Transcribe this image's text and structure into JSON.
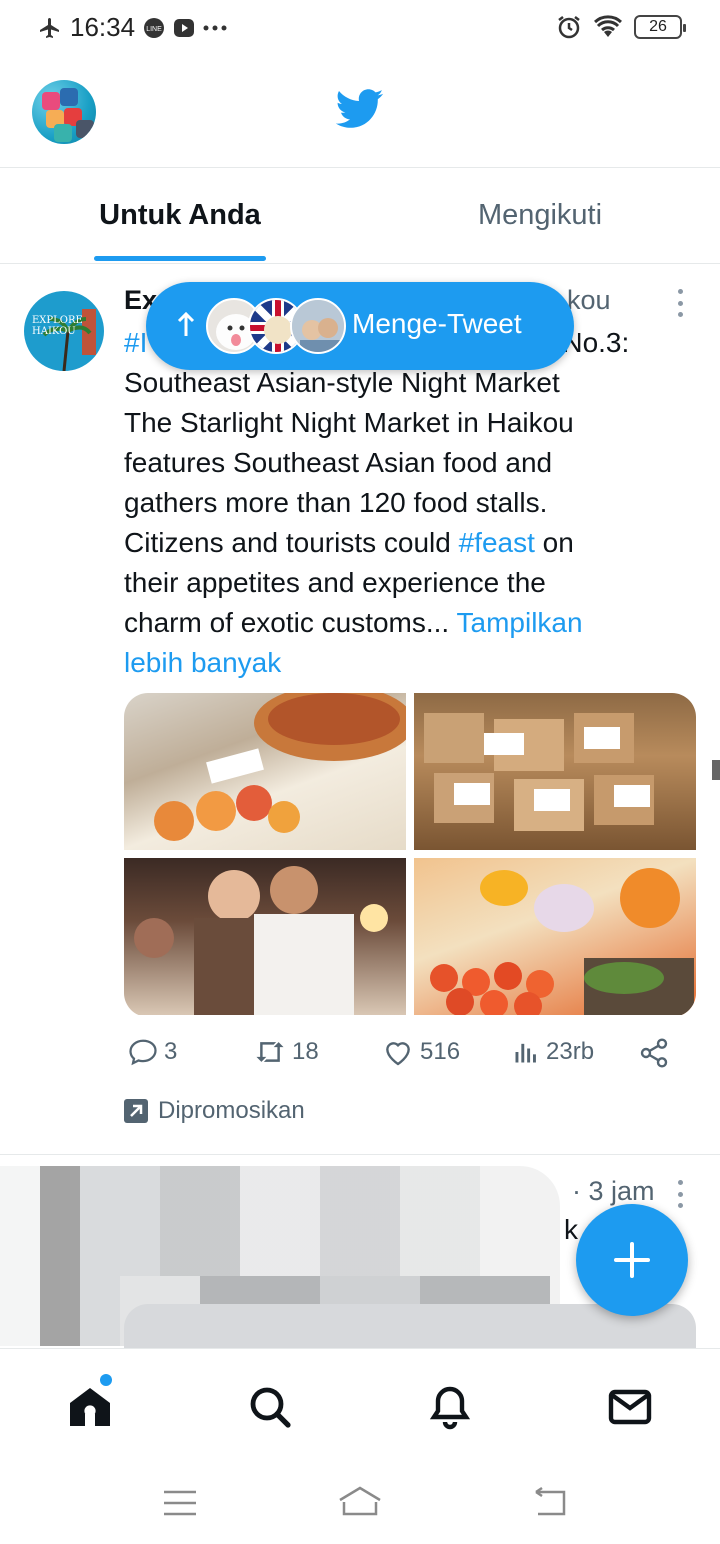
{
  "status_bar": {
    "time": "16:34",
    "battery": "26"
  },
  "header": {
    "logo_icon": "twitter-bird-icon",
    "brand_color": "#1d9bf0"
  },
  "tabs": [
    {
      "label": "Untuk Anda",
      "active": true
    },
    {
      "label": "Mengikuti",
      "active": false
    }
  ],
  "new_tweets_pill": {
    "label": "Menge-Tweet"
  },
  "tweet": {
    "name_visible": "Ex",
    "handle_tail_visible": "kou",
    "text_line1_prefix": "#I",
    "text_line1_suffix": "n No.3:",
    "text_line2": "Southeast Asian-style Night Market",
    "text_line3": "The Starlight Night Market in Haikou",
    "text_line4": "features Southeast Asian food and",
    "text_line5": "gathers more than 120 food stalls.",
    "text_line6_a": "Citizens and tourists could ",
    "text_line6_hashtag": "#feast",
    "text_line6_b": " on",
    "text_line7": "their appetites and experience the",
    "text_line8_a": "charm of exotic customs... ",
    "text_line8_link": "Tampilkan",
    "text_line9_link": "lebih banyak",
    "avatar_text": "EXPLORE HAIKOU",
    "actions": {
      "replies": "3",
      "retweets": "18",
      "likes": "516",
      "views": "23rb"
    },
    "promoted_label": "Dipromosikan"
  },
  "tweet2": {
    "time": "· 3 jam",
    "partial_char": "k"
  }
}
